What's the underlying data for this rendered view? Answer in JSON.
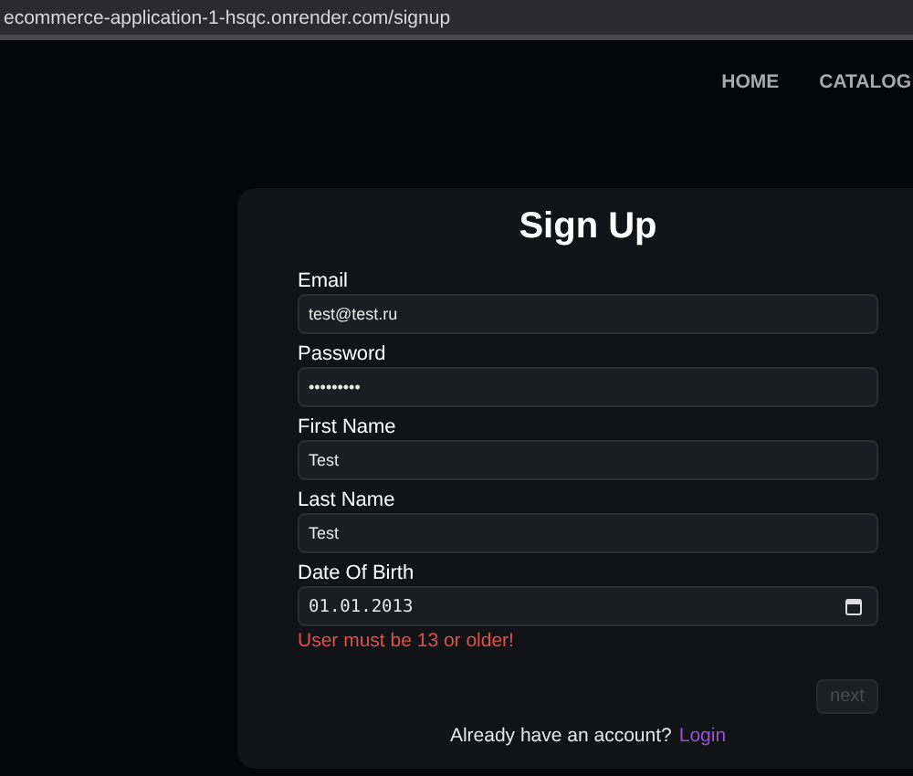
{
  "browser": {
    "address": "ecommerce-application-1-hsqc.onrender.com/signup"
  },
  "nav": [
    {
      "label": "HOME"
    },
    {
      "label": "CATALOG"
    }
  ],
  "form": {
    "title": "Sign Up",
    "fields": [
      {
        "kind": "text",
        "label": "Email",
        "value": "test@test.ru"
      },
      {
        "kind": "text",
        "label": "Password",
        "value": "•••••••••"
      },
      {
        "kind": "text",
        "label": "First Name",
        "value": "Test"
      },
      {
        "kind": "text",
        "label": "Last Name",
        "value": "Test"
      },
      {
        "kind": "date",
        "label": "Date Of Birth",
        "value": "01.01.2013",
        "error": "User must be 13 or older!"
      }
    ],
    "submit": {
      "label": "next",
      "disabled": true
    },
    "footer": {
      "text": "Already have an account?",
      "link": "Login"
    }
  }
}
